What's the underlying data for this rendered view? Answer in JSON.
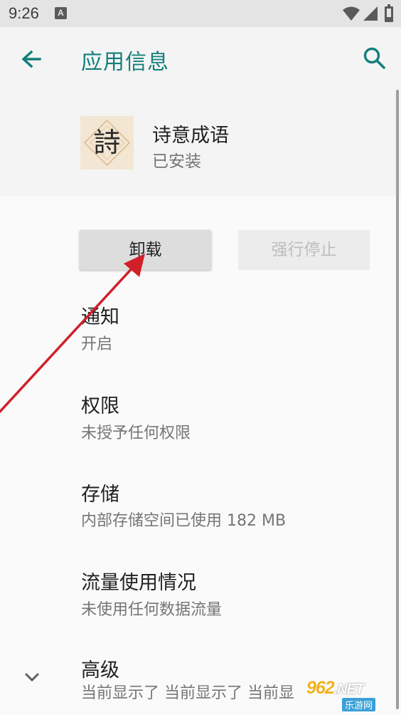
{
  "status_bar": {
    "time": "9:26",
    "notification_letter": "A",
    "icons": [
      "notification-a-icon",
      "wifi-icon",
      "signal-icon",
      "battery-icon"
    ]
  },
  "toolbar": {
    "title": "应用信息",
    "back_icon": "back-arrow-icon",
    "search_icon": "search-icon"
  },
  "app": {
    "name": "诗意成语",
    "status": "已安装",
    "icon_glyph": "詩"
  },
  "buttons": {
    "uninstall": "卸载",
    "force_stop": "强行停止"
  },
  "settings": [
    {
      "title": "通知",
      "subtitle": "开启"
    },
    {
      "title": "权限",
      "subtitle": "未授予任何权限"
    },
    {
      "title": "存储",
      "subtitle": "内部存储空间已使用 182 MB"
    },
    {
      "title": "流量使用情况",
      "subtitle": "未使用任何数据流量"
    },
    {
      "title": "高级",
      "subtitle": "当前显示了 当前显示了 当前显"
    }
  ],
  "watermark": {
    "main": "962",
    "domain": ".NET",
    "sub": "乐游网"
  },
  "colors": {
    "accent": "#127f7a",
    "annotation_arrow": "#d0202a",
    "header_bg": "#f4f4f4",
    "status_bar_bg": "#e4e4e4"
  }
}
